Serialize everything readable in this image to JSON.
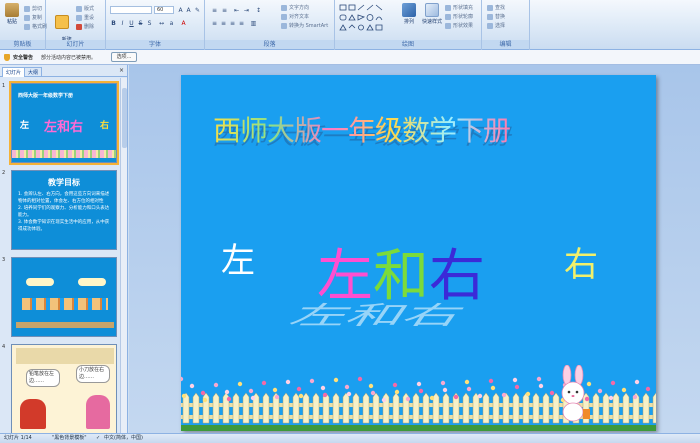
{
  "ribbon": {
    "clipboard": {
      "paste_label": "粘贴",
      "cut_label": "剪切",
      "copy_label": "复制",
      "format_painter_label": "格式刷",
      "group_label": "剪贴板"
    },
    "slides": {
      "new_slide_label": "新建\n幻灯片",
      "layout_label": "版式",
      "reset_label": "重设",
      "delete_label": "删除",
      "group_label": "幻灯片"
    },
    "font": {
      "size_value": "60",
      "group_label": "字体"
    },
    "paragraph": {
      "text_direction_label": "文字方向",
      "align_text_label": "对齐文本",
      "smartart_label": "转换为 SmartArt",
      "group_label": "段落"
    },
    "drawing": {
      "arrange_label": "排列",
      "quick_styles_label": "快速样式",
      "shape_fill_label": "形状填充",
      "shape_outline_label": "形状轮廓",
      "shape_effects_label": "形状效果",
      "group_label": "绘图"
    },
    "editing": {
      "find_label": "查找",
      "replace_label": "替换",
      "select_label": "选择",
      "group_label": "编辑"
    }
  },
  "security_bar": {
    "title": "安全警告",
    "message": "部分活动内容已被禁用。",
    "options_button": "选项..."
  },
  "left_pane": {
    "tab_slides": "幻灯片",
    "tab_outline": "大纲",
    "close_glyph": "×",
    "thumbnails": [
      {
        "number": "1",
        "title": "西师大版一年级数学下册",
        "left_char": "左",
        "main": "左和右",
        "right_char": "右"
      },
      {
        "number": "2",
        "heading": "教学目标",
        "items": [
          "1. 会辨认左、右方向，会用这些方向词来描述物体的相对位置，体会左、右方位的相对性",
          "2. 培养同学们的观察力、分析能力和口头表达能力。",
          "3. 体会数学知识在现实生活中的应用，从中获得成功体验。"
        ]
      },
      {
        "number": "3"
      },
      {
        "number": "4",
        "bubble_left": "铅笔放在左边……",
        "bubble_right": "小刀放在右边……"
      }
    ]
  },
  "slide": {
    "title": "西师大版一年级数学下册",
    "left_char": "左",
    "main_chars": [
      "左",
      "和",
      "右"
    ],
    "right_char": "右",
    "main_colors": [
      "#ff4fd0",
      "#7cdb3a",
      "#3b2ad8"
    ]
  },
  "status_bar": {
    "slide_counter": "幻灯片 1/14",
    "theme": "\"黑色背景模板\"",
    "language": "中文(简体，中国)"
  }
}
